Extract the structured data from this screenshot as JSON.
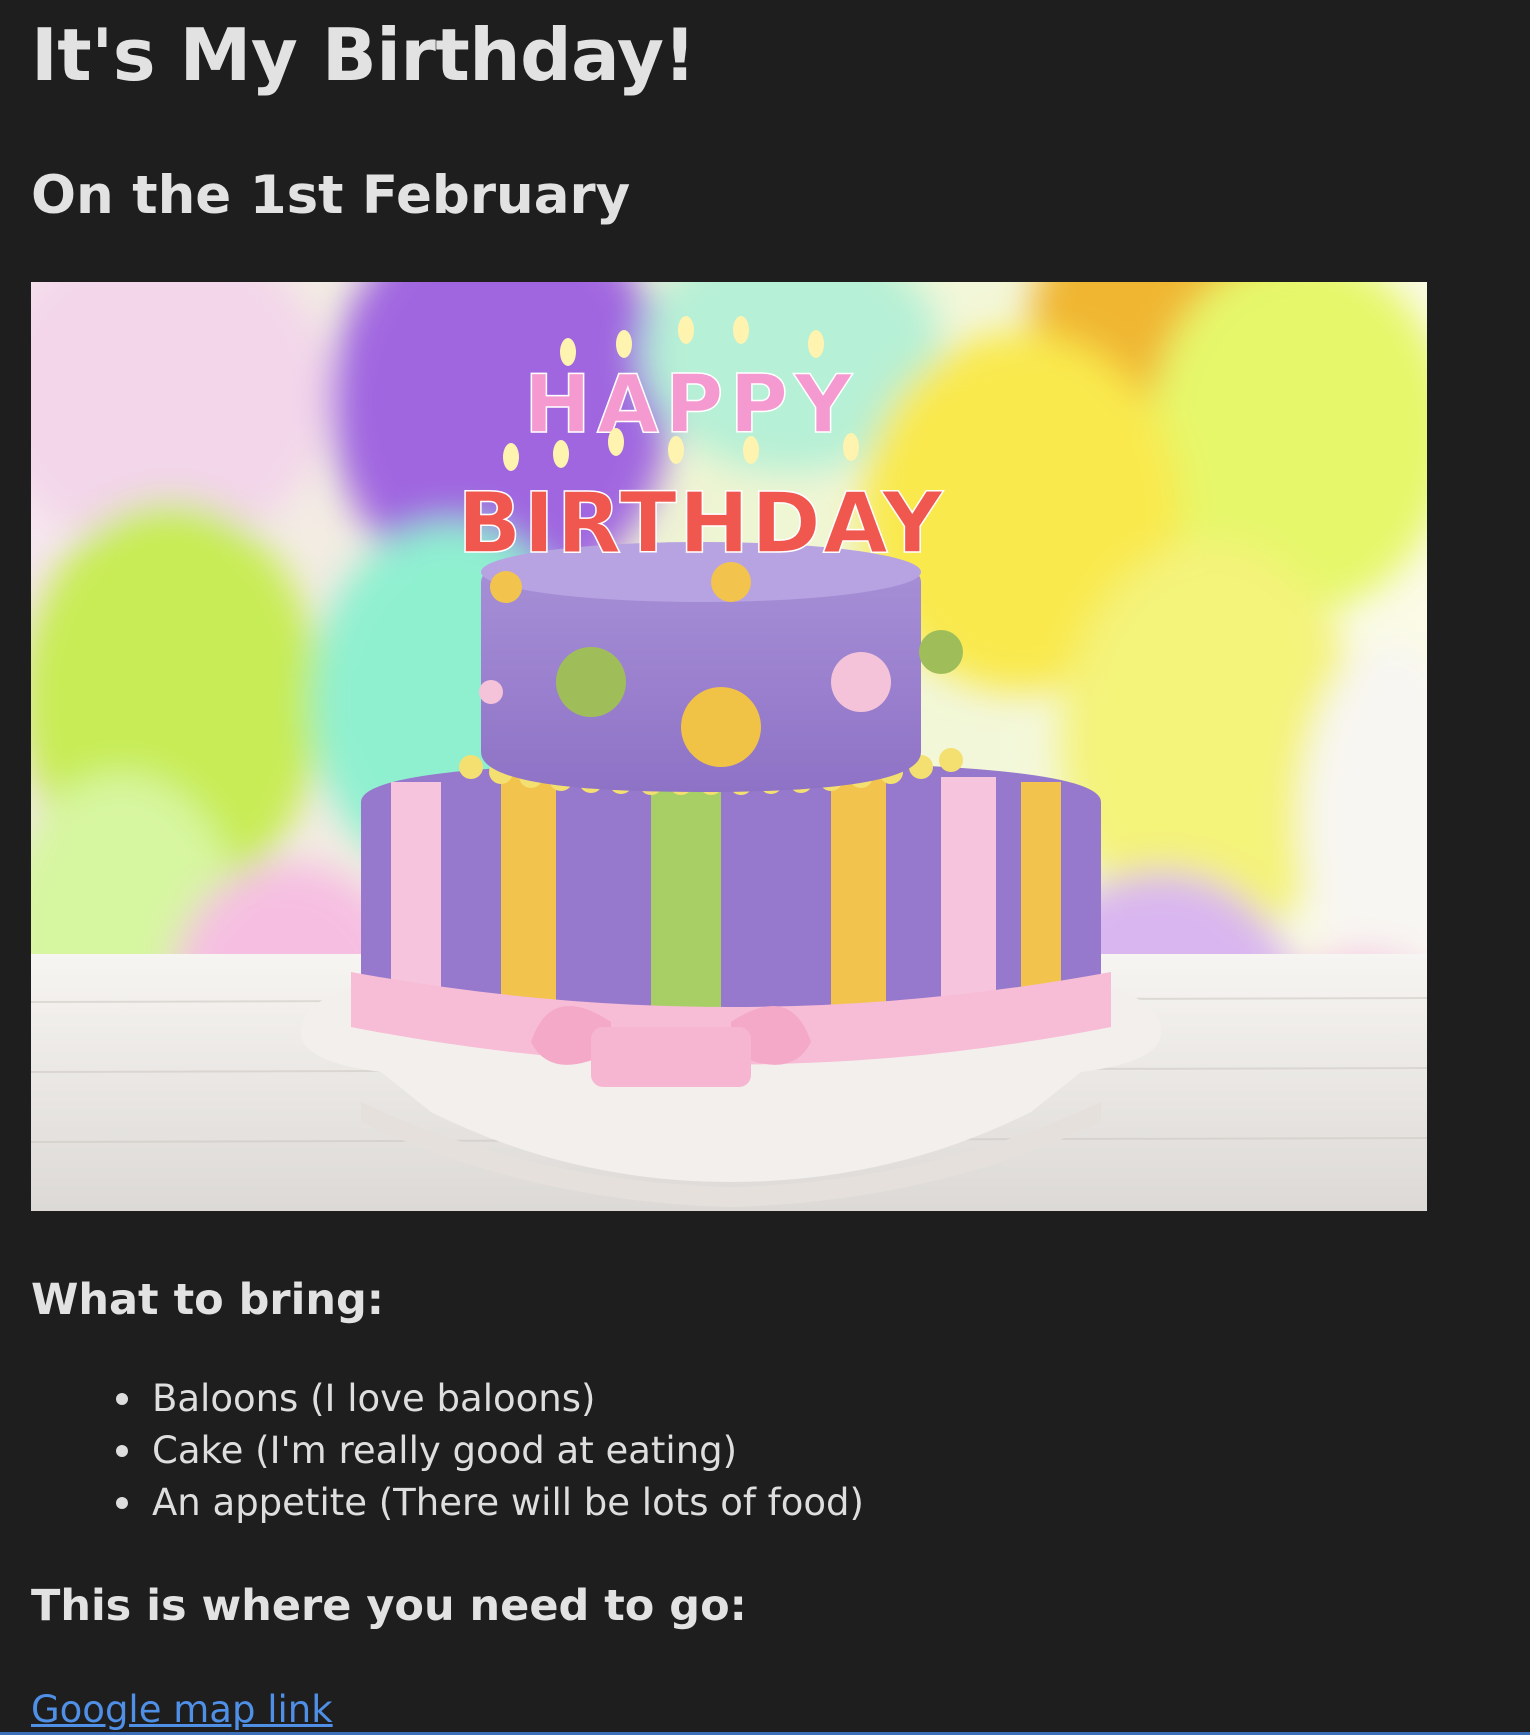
{
  "page": {
    "title": "It's My Birthday!",
    "subtitle": "On the 1st February"
  },
  "hero_image": {
    "icon": "birthday-cake-photo",
    "candle_text_top": "HAPPY",
    "candle_text_bottom": "BIRTHDAY"
  },
  "bring": {
    "heading": "What to bring:",
    "items": [
      "Baloons (I love baloons)",
      "Cake (I'm really good at eating)",
      "An appetite (There will be lots of food)"
    ]
  },
  "location": {
    "heading": "This is where you need to go:",
    "link_text": "Google map link"
  },
  "colors": {
    "background": "#1e1e1e",
    "text": "#dedede",
    "link": "#4f8fe6"
  }
}
